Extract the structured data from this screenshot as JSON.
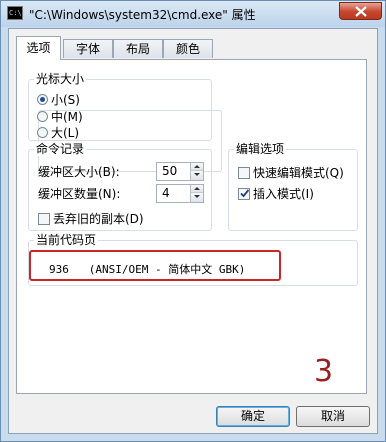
{
  "window": {
    "title": "\"C:\\Windows\\system32\\cmd.exe\" 属性",
    "icon_text": "C:\\"
  },
  "tabs": [
    "选项",
    "字体",
    "布局",
    "颜色"
  ],
  "cursor_size": {
    "label": "光标大小",
    "options": [
      "小(S)",
      "中(M)",
      "大(L)"
    ],
    "selected": "小(S)"
  },
  "command_history": {
    "label": "命令记录",
    "buffer_size_label": "缓冲区大小(B):",
    "buffer_size_value": "50",
    "buffer_count_label": "缓冲区数量(N):",
    "buffer_count_value": "4",
    "discard_duplicates_label": "丢弃旧的副本(D)",
    "discard_duplicates_checked": false
  },
  "edit_options": {
    "label": "编辑选项",
    "quick_edit_label": "快速编辑模式(Q)",
    "quick_edit_checked": false,
    "insert_mode_label": "插入模式(I)",
    "insert_mode_checked": true
  },
  "code_page": {
    "label": "当前代码页",
    "value": "936   (ANSI/OEM - 简体中文 GBK)"
  },
  "annotation": {
    "number": "3",
    "highlight_color": "#c8262a"
  },
  "buttons": {
    "ok": "确定",
    "cancel": "取消"
  }
}
